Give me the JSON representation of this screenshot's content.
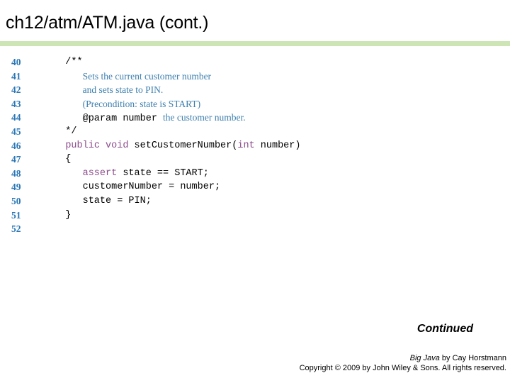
{
  "slide": {
    "title": "ch12/atm/ATM.java (cont.)",
    "rule_color": "#cde5b5",
    "continued_label": "Continued"
  },
  "code": {
    "line_number_color": "#2a76b4",
    "keyword_color": "#8a4a8a",
    "comment_color": "#3c7fae",
    "lines": [
      {
        "no": "40",
        "segments": [
          {
            "text": "   /**",
            "kind": "comment"
          }
        ]
      },
      {
        "no": "41",
        "segments": [
          {
            "text": "      ",
            "kind": "plain"
          },
          {
            "text": "Sets the current customer number",
            "kind": "doc"
          }
        ]
      },
      {
        "no": "42",
        "segments": [
          {
            "text": "      ",
            "kind": "plain"
          },
          {
            "text": "and sets state to PIN.",
            "kind": "doc"
          }
        ]
      },
      {
        "no": "43",
        "segments": [
          {
            "text": "      ",
            "kind": "plain"
          },
          {
            "text": "(Precondition: state is START)",
            "kind": "doc"
          }
        ]
      },
      {
        "no": "44",
        "segments": [
          {
            "text": "      ",
            "kind": "plain"
          },
          {
            "text": "@param number ",
            "kind": "docmono"
          },
          {
            "text": "the customer number.",
            "kind": "doc"
          }
        ]
      },
      {
        "no": "45",
        "segments": [
          {
            "text": "   */",
            "kind": "comment"
          }
        ]
      },
      {
        "no": "46",
        "segments": [
          {
            "text": "   ",
            "kind": "plain"
          },
          {
            "text": "public void ",
            "kind": "keyword"
          },
          {
            "text": "setCustomerNumber(",
            "kind": "plain"
          },
          {
            "text": "int",
            "kind": "keyword"
          },
          {
            "text": " number)",
            "kind": "plain"
          }
        ]
      },
      {
        "no": "47",
        "segments": [
          {
            "text": "   {",
            "kind": "plain"
          }
        ]
      },
      {
        "no": "48",
        "segments": [
          {
            "text": "      ",
            "kind": "plain"
          },
          {
            "text": "assert",
            "kind": "keyword"
          },
          {
            "text": " state == START;",
            "kind": "plain"
          }
        ]
      },
      {
        "no": "49",
        "segments": [
          {
            "text": "      customerNumber = number;",
            "kind": "plain"
          }
        ]
      },
      {
        "no": "50",
        "segments": [
          {
            "text": "      state = PIN;",
            "kind": "plain"
          }
        ]
      },
      {
        "no": "51",
        "segments": [
          {
            "text": "   }",
            "kind": "plain"
          }
        ]
      },
      {
        "no": "52",
        "segments": []
      }
    ]
  },
  "footer": {
    "book_title": "Big Java",
    "byline": " by Cay Horstmann",
    "copyright": "Copyright © 2009 by John Wiley & Sons.  All rights reserved."
  }
}
